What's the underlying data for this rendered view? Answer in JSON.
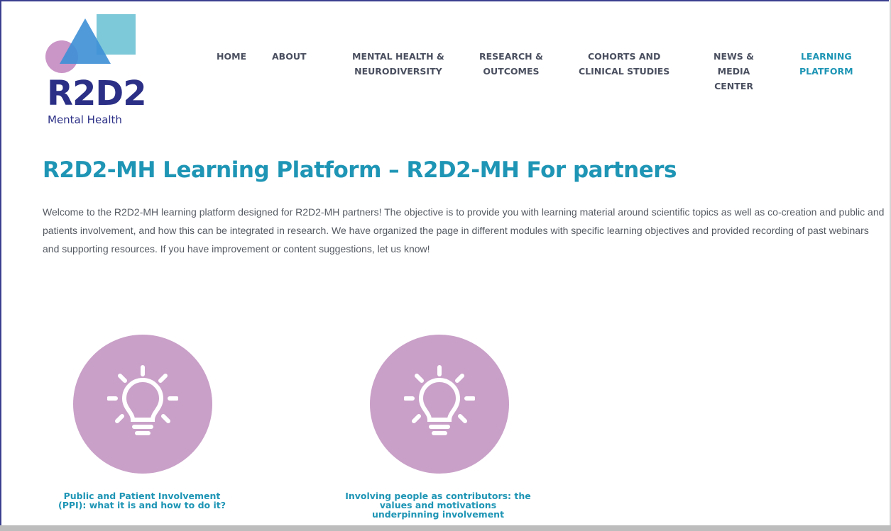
{
  "logo": {
    "wordmark": "R2D2",
    "subtitle": "Mental Health",
    "colors": {
      "square": "#7ec9d9",
      "circle": "#c78fc4",
      "triangle": "#3d8fd6",
      "text": "#2b2f86"
    }
  },
  "nav": {
    "items": [
      {
        "label": "HOME",
        "active": false
      },
      {
        "label": "ABOUT",
        "active": false
      },
      {
        "label": "MENTAL HEALTH &\nNEURODIVERSITY",
        "active": false
      },
      {
        "label": "RESEARCH &\nOUTCOMES",
        "active": false
      },
      {
        "label": "COHORTS AND\nCLINICAL STUDIES",
        "active": false
      },
      {
        "label": "NEWS &\nMEDIA\nCENTER",
        "active": false
      },
      {
        "label": "LEARNING\nPLATFORM",
        "active": true
      }
    ]
  },
  "page": {
    "title": "R2D2-MH Learning Platform – R2D2-MH For partners",
    "intro": "Welcome to the R2D2-MH learning platform designed for R2D2-MH partners! The objective is to provide you with learning material around scientific topics as well as co-creation and public and patients involvement, and how this can be integrated in research. We have organized the page in different modules with specific learning objectives and provided recording of past webinars and supporting resources. If you have improvement or content suggestions, let us know!"
  },
  "modules": [
    {
      "icon": "lightbulb-icon",
      "caption": "Public and Patient Involvement\n(PPI): what it is and how to do it?"
    },
    {
      "icon": "lightbulb-icon",
      "caption": "Involving people as contributors: the\nvalues and motivations\nunderpinning involvement"
    }
  ],
  "colors": {
    "accent": "#1e95b5",
    "nav_text": "#4b5060",
    "circle": "#c9a0c8",
    "body_text": "#555a62"
  }
}
